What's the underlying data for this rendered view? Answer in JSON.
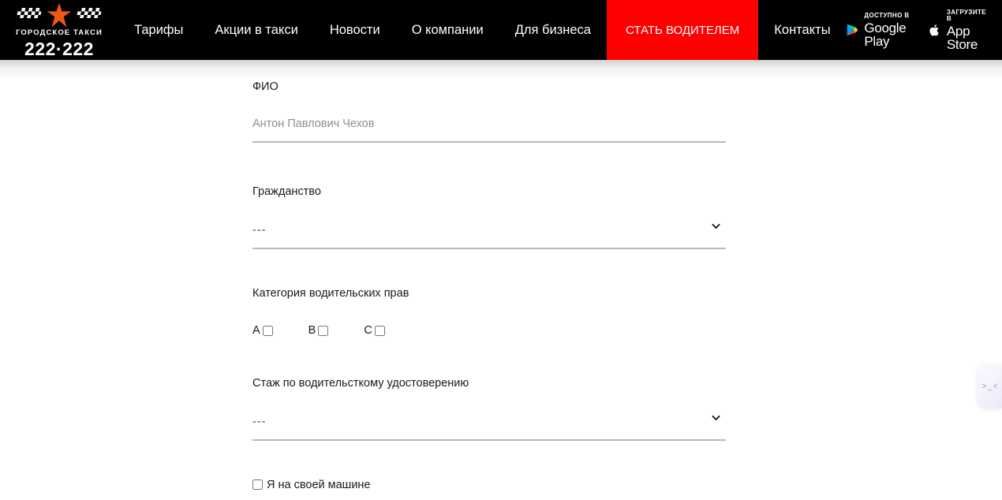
{
  "header": {
    "logo": {
      "subtitle": "ГОРОДСКОЕ ТАКСИ",
      "phone": "222·222",
      "star_color": "#ef5713"
    },
    "nav": [
      {
        "label": "Тарифы",
        "highlight": false
      },
      {
        "label": "Акции в такси",
        "highlight": false
      },
      {
        "label": "Новости",
        "highlight": false
      },
      {
        "label": "О компании",
        "highlight": false
      },
      {
        "label": "Для бизнеса",
        "highlight": false
      },
      {
        "label": "СТАТЬ ВОДИТЕЛЕМ",
        "highlight": true
      },
      {
        "label": "Контакты",
        "highlight": false
      }
    ],
    "highlight_color": "#fe0000",
    "background_color": "#000000",
    "stores": [
      {
        "small": "ДОСТУПНО В",
        "big": "Google Play",
        "icon": "google-play-icon"
      },
      {
        "small": "Загрузите в",
        "big": "App Store",
        "icon": "apple-icon"
      }
    ]
  },
  "form": {
    "fio": {
      "label": "ФИО",
      "placeholder": "Антон Павлович Чехов",
      "value": ""
    },
    "citizenship": {
      "label": "Гражданство",
      "selected": "---"
    },
    "license_category": {
      "label": "Категория водительских прав",
      "options": [
        {
          "label": "A",
          "checked": false
        },
        {
          "label": "B",
          "checked": false
        },
        {
          "label": "C",
          "checked": false
        }
      ]
    },
    "experience": {
      "label": "Стаж по водительсткому удостоверению",
      "selected": "---"
    },
    "own_car": {
      "label": "Я на своей машине",
      "checked": false
    }
  },
  "side_widget": {
    "face": ">_<"
  }
}
